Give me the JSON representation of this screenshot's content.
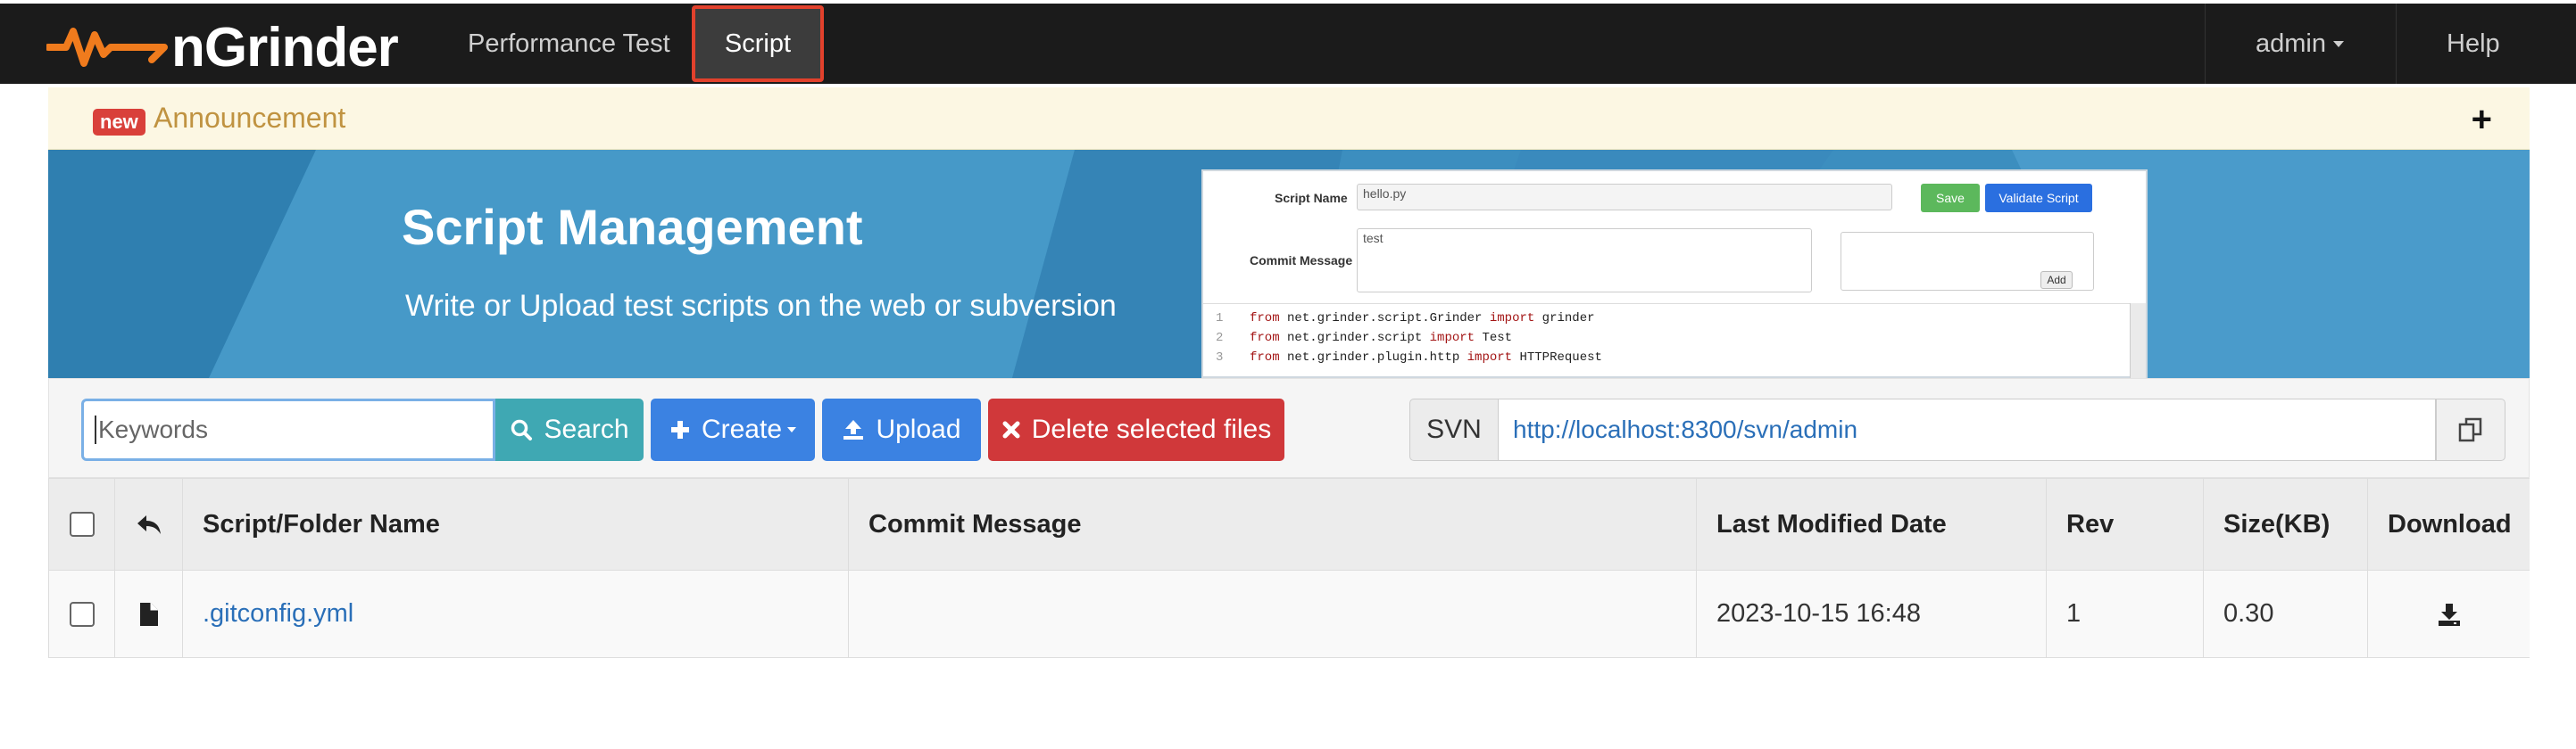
{
  "nav": {
    "brand": "nGrinder",
    "items": [
      {
        "label": "Performance Test",
        "active": false
      },
      {
        "label": "Script",
        "active": true
      }
    ],
    "admin": "admin",
    "help": "Help"
  },
  "announcement": {
    "badge": "new",
    "text": "Announcement",
    "toggle": "+"
  },
  "banner": {
    "title": "Script Management",
    "subtitle": "Write or Upload test scripts on the web or subversion",
    "preview": {
      "script_name_label": "Script Name",
      "script_name_value": "hello.py",
      "save_label": "Save",
      "validate_label": "Validate Script",
      "commit_label": "Commit Message",
      "commit_value": "test",
      "add_label": "Add",
      "code_lines": [
        {
          "no": "1",
          "kw1": "from",
          "mod": " net.grinder.script.Grinder ",
          "kw2": "import",
          "name": " grinder"
        },
        {
          "no": "2",
          "kw1": "from",
          "mod": " net.grinder.script ",
          "kw2": "import",
          "name": " Test"
        },
        {
          "no": "3",
          "kw1": "from",
          "mod": " net.grinder.plugin.http ",
          "kw2": "import",
          "name": " HTTPRequest"
        }
      ]
    }
  },
  "toolbar": {
    "search_placeholder": "Keywords",
    "search_label": "Search",
    "create_label": "Create",
    "upload_label": "Upload",
    "delete_label": "Delete selected files",
    "svn_label": "SVN",
    "svn_url": "http://localhost:8300/svn/admin"
  },
  "table": {
    "headers": {
      "name": "Script/Folder Name",
      "commit": "Commit Message",
      "date": "Last Modified Date",
      "rev": "Rev",
      "size": "Size(KB)",
      "download": "Download"
    },
    "rows": [
      {
        "name": ".gitconfig.yml",
        "commit": "",
        "date": "2023-10-15 16:48",
        "rev": "1",
        "size": "0.30"
      }
    ]
  },
  "colors": {
    "navbar_bg": "#1b1b1b",
    "active_tab_border": "#e2412c",
    "brand_orange": "#f07b1d",
    "banner_bg": "#3c8ebf",
    "search_btn": "#3fa8b3",
    "primary_btn": "#3b82e2",
    "danger_btn": "#d0383a",
    "link": "#2a6fb8"
  },
  "icons": [
    "ngrinder-logo-icon",
    "caret-down-icon",
    "search-icon",
    "plus-icon",
    "upload-icon",
    "close-icon",
    "copy-icon",
    "reply-icon",
    "file-icon",
    "download-icon"
  ]
}
